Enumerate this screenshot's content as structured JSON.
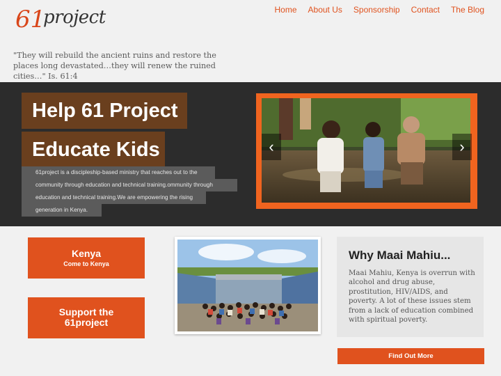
{
  "header": {
    "logo_num": "61",
    "logo_text": "project",
    "nav": [
      "Home",
      "About Us",
      "Sponsorship",
      "Contact",
      "The Blog"
    ],
    "quote": "\"They will rebuild the ancient ruins and restore the places long devastated…they will renew the ruined cities…\" Is. 61:4"
  },
  "hero": {
    "headline_1": "Help 61 Project",
    "headline_2": "Educate Kids",
    "description_lines": [
      "61project is a discipleship-based ministry that reaches out to the",
      "community through education and technical training.ommunity through",
      "education and technical training.We are empowering the rising",
      "generation in Kenya."
    ],
    "prev_label": "‹",
    "next_label": "›"
  },
  "cta": {
    "kenya_title": "Kenya",
    "kenya_subtitle": "Come to Kenya",
    "support_line1": "Support the",
    "support_line2": "61project"
  },
  "why": {
    "title": "Why Maai Mahiu...",
    "body": "Maai Mahiu, Kenya is overrun with alcohol and drug abuse, prostitution, HIV/AIDS, and poverty. A lot of these issues stem from a lack of education combined with spiritual poverty.",
    "button": "Find Out More"
  },
  "colors": {
    "accent": "#e0521e",
    "headline_bg": "#6a3f1e",
    "hero_bg": "#2c2c2c"
  }
}
